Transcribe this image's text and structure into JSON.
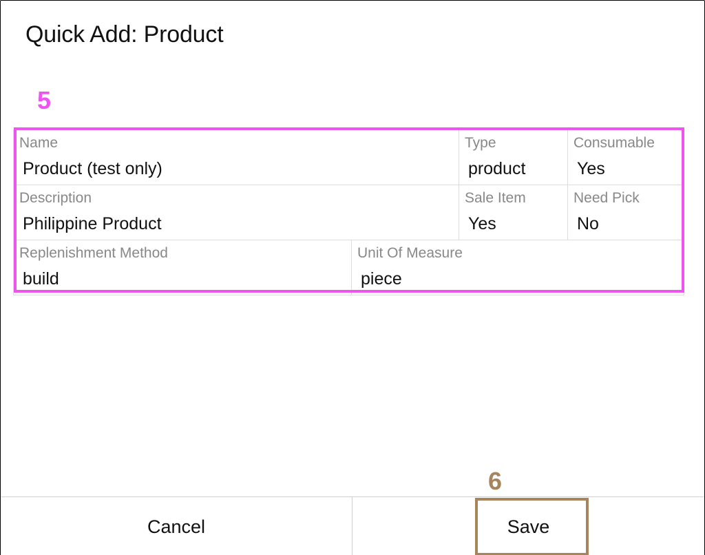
{
  "dialog": {
    "title": "Quick Add: Product"
  },
  "markers": {
    "form": "5",
    "save": "6"
  },
  "fields": {
    "name": {
      "label": "Name",
      "value": "Product (test only)"
    },
    "type": {
      "label": "Type",
      "value": "product"
    },
    "consumable": {
      "label": "Consumable",
      "value": "Yes"
    },
    "description": {
      "label": "Description",
      "value": "Philippine Product"
    },
    "sale_item": {
      "label": "Sale Item",
      "value": "Yes"
    },
    "need_pick": {
      "label": "Need Pick",
      "value": "No"
    },
    "replenishment_method": {
      "label": "Replenishment Method",
      "value": "build"
    },
    "unit_of_measure": {
      "label": "Unit Of Measure",
      "value": "piece"
    }
  },
  "footer": {
    "cancel_label": "Cancel",
    "save_label": "Save"
  },
  "colors": {
    "form_highlight": "#ee55ee",
    "save_highlight": "#a8845c"
  }
}
